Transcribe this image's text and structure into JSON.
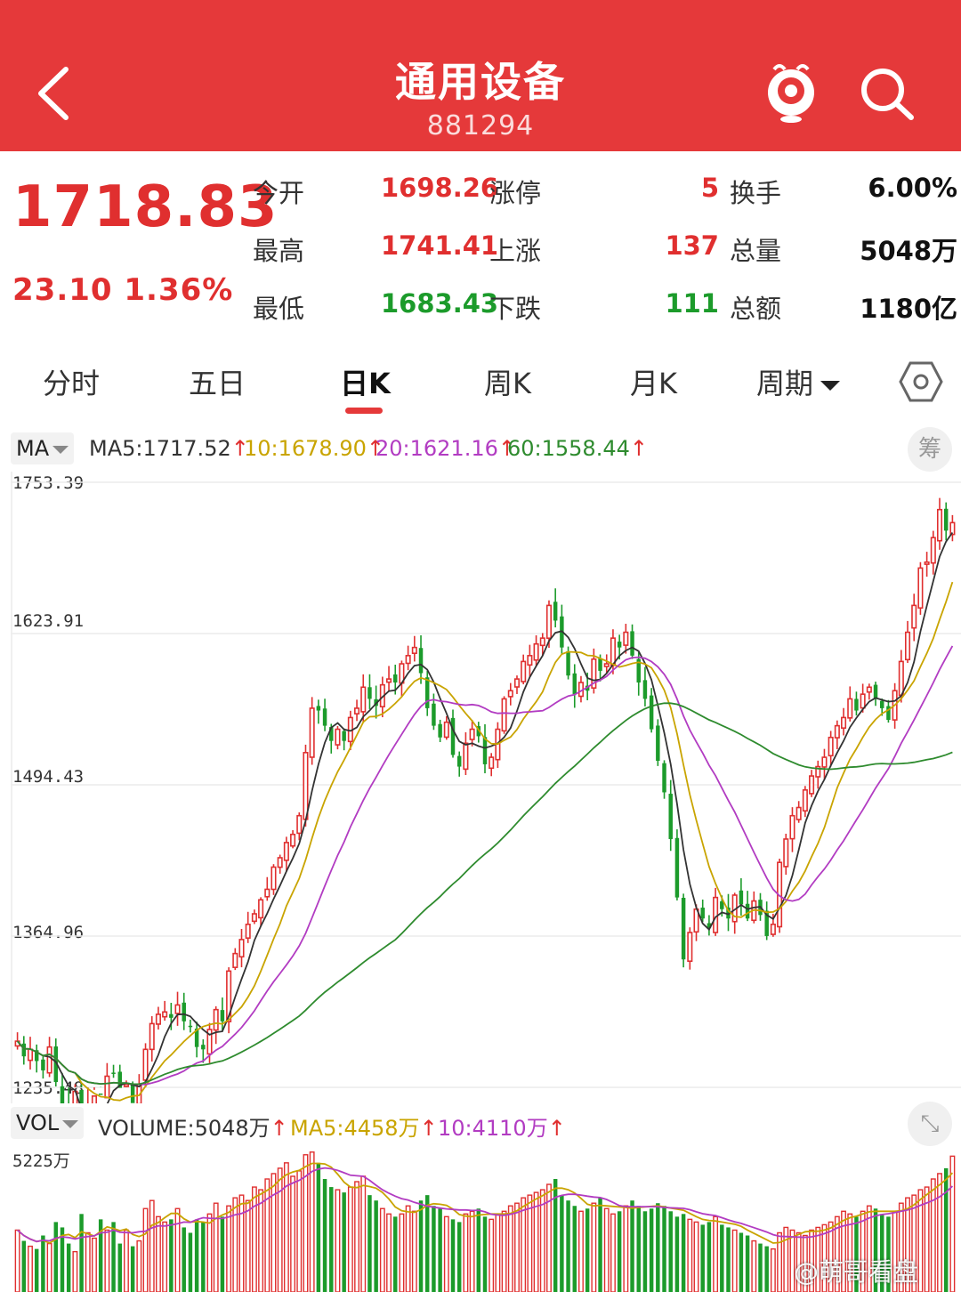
{
  "header": {
    "title": "通用设备",
    "code": "881294",
    "bg_color": "#e5393a"
  },
  "quote": {
    "price": "1718.83",
    "change": "23.10",
    "change_pct": "1.36%",
    "rows": [
      {
        "l1": "今开",
        "v1": "1698.26",
        "l2": "涨停",
        "v2": "5",
        "l3": "换手",
        "v3": "6.00%"
      },
      {
        "l1": "最高",
        "v1": "1741.41",
        "l2": "上涨",
        "v2": "137",
        "l3": "总量",
        "v3": "5048万"
      },
      {
        "l1": "最低",
        "v1": "1683.43",
        "l2": "下跌",
        "v2": "111",
        "l3": "总额",
        "v3": "1180亿"
      }
    ]
  },
  "tabs": [
    {
      "label": "分时"
    },
    {
      "label": "五日"
    },
    {
      "label": "日K",
      "active": true
    },
    {
      "label": "周K"
    },
    {
      "label": "月K"
    },
    {
      "label": "周期"
    }
  ],
  "ma": {
    "selector": "MA",
    "ma5": "MA5:1717.52",
    "ma10": "10:1678.90",
    "ma20": "20:1621.16",
    "ma60": "60:1558.44",
    "chip_label": "筹",
    "colors": {
      "ma5": "#333333",
      "ma10": "#c9a400",
      "ma20": "#b23cc2",
      "ma60": "#2e8b2e"
    }
  },
  "price_axis": [
    "1753.39",
    "1623.91",
    "1494.43",
    "1364.96",
    "1235.48"
  ],
  "vol": {
    "selector": "VOL",
    "volume": "VOLUME:5048万",
    "ma5": "MA5:4458万",
    "ma10": "10:4110万",
    "max_label": "5225万"
  },
  "watermark": "@萌哥看盘",
  "chart_data": {
    "type": "candlestick",
    "ylim": [
      1235.48,
      1753.39
    ],
    "series": [
      {
        "name": "MA5",
        "value": 1717.52
      },
      {
        "name": "10",
        "value": 1678.9
      },
      {
        "name": "20",
        "value": 1621.16
      },
      {
        "name": "60",
        "value": 1558.44
      }
    ],
    "close": [
      1275,
      1262,
      1268,
      1258,
      1250,
      1270,
      1240,
      1215,
      1208,
      1232,
      1190,
      1212,
      1228,
      1230,
      1245,
      1248,
      1235,
      1238,
      1222,
      1238,
      1268,
      1290,
      1298,
      1300,
      1295,
      1306,
      1292,
      1288,
      1270,
      1268,
      1285,
      1302,
      1292,
      1335,
      1350,
      1362,
      1375,
      1384,
      1396,
      1405,
      1424,
      1432,
      1445,
      1452,
      1468,
      1522,
      1560,
      1558,
      1545,
      1532,
      1542,
      1532,
      1552,
      1560,
      1578,
      1568,
      1562,
      1580,
      1585,
      1582,
      1598,
      1605,
      1612,
      1590,
      1560,
      1545,
      1535,
      1548,
      1520,
      1510,
      1530,
      1542,
      1536,
      1512,
      1518,
      1542,
      1568,
      1575,
      1585,
      1600,
      1605,
      1615,
      1620,
      1648,
      1635,
      1612,
      1588,
      1572,
      1582,
      1575,
      1602,
      1592,
      1598,
      1620,
      1612,
      1625,
      1605,
      1582,
      1568,
      1542,
      1515,
      1488,
      1448,
      1398,
      1345,
      1368,
      1388,
      1380,
      1372,
      1398,
      1388,
      1380,
      1400,
      1392,
      1380,
      1395,
      1383,
      1365,
      1375,
      1428,
      1448,
      1468,
      1475,
      1490,
      1502,
      1510,
      1518,
      1535,
      1545,
      1552,
      1568,
      1558,
      1572,
      1578,
      1568,
      1560,
      1550,
      1575,
      1600,
      1625,
      1648,
      1680,
      1685,
      1706,
      1730,
      1712,
      1718.83
    ],
    "volume": [
      2300,
      1900,
      1700,
      1600,
      2100,
      1800,
      2600,
      2400,
      1800,
      1500,
      2900,
      2200,
      2000,
      2700,
      2300,
      2600,
      1800,
      2300,
      1700,
      1900,
      3100,
      3400,
      2800,
      2600,
      2700,
      3100,
      2400,
      2200,
      2700,
      2600,
      2900,
      3300,
      2800,
      3200,
      3500,
      3600,
      3400,
      3900,
      3800,
      4200,
      4400,
      4600,
      4800,
      4300,
      4500,
      5100,
      5200,
      4800,
      4200,
      3900,
      3800,
      3700,
      3900,
      4100,
      4300,
      3600,
      3400,
      3100,
      2900,
      2800,
      2900,
      3200,
      3000,
      3400,
      3600,
      3200,
      3100,
      2800,
      2700,
      2600,
      2900,
      3000,
      3100,
      2800,
      2700,
      2900,
      3000,
      3200,
      3300,
      3500,
      3600,
      3700,
      3800,
      4000,
      4200,
      3600,
      3400,
      3200,
      3000,
      3100,
      3300,
      3500,
      3100,
      2900,
      3000,
      3200,
      3400,
      3200,
      3000,
      3100,
      3300,
      3200,
      3000,
      2800,
      2900,
      2700,
      2600,
      2500,
      2600,
      2800,
      2500,
      2400,
      2300,
      2200,
      2100,
      1900,
      1800,
      1700,
      1600,
      2200,
      2400,
      2300,
      2200,
      2100,
      2300,
      2400,
      2500,
      2600,
      2800,
      3000,
      2900,
      2800,
      3000,
      3200,
      3100,
      2900,
      2800,
      3000,
      3300,
      3500,
      3600,
      3800,
      3900,
      4200,
      4400,
      4600,
      5048
    ]
  }
}
